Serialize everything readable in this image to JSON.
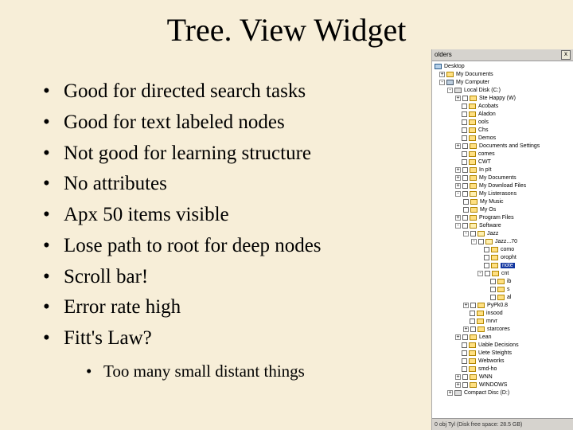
{
  "title": "Tree. View Widget",
  "bullets": [
    "Good for directed search tasks",
    "Good for text labeled nodes",
    "Not good for learning structure",
    "No attributes",
    "Apx 50 items visible",
    "Lose path to root for deep nodes",
    "Scroll bar!",
    "Error rate high",
    "Fitt's Law?"
  ],
  "sub_bullet": "Too many small distant things",
  "explorer": {
    "panel_title": "olders",
    "close_glyph": "x",
    "status": "0 obj Tyl (Disk free space: 28.5 GB)",
    "expander_minus": "-",
    "expander_plus": "+",
    "nodes": {
      "desktop": "Desktop",
      "my_documents": "My Documents",
      "my_computer": "My Computer",
      "local_disk": "Local Disk (C:)",
      "ste_happy": "Ste Happy (W)",
      "acobats": "Acobats",
      "aladon": "Aladon",
      "ools": "ools",
      "chs": "Chs",
      "demos": "Demos",
      "docs_settings": "Documents and Settings",
      "comes": "comes",
      "cwt": "CWT",
      "in_pit": "In pIt",
      "my_docs2": "My Documents",
      "my_download": "My Download Files",
      "my_lister": "My Listerasons",
      "my_music": "My Music",
      "my_os": "My Os",
      "program_files": "Program Files",
      "software": "Software",
      "jazz": "Jazz",
      "jazz_sub": "Jazz...70",
      "como": "como",
      "oropht": "oropht",
      "sel_item": "note",
      "cnt": "cnt",
      "ib": "ib",
      "s": "s",
      "al": "al",
      "pypk08": "PyPk0.8",
      "insood": "insood",
      "mrvr": "mrvr",
      "starcores": "starcores",
      "lean": "Lean",
      "uable": "Uable Decisions",
      "uete": "Uete Steights",
      "webworks": "Webworks",
      "smd_ho": "smd-ho",
      "wnn": "WNN",
      "windows": "WINDOWS",
      "cd_drive": "Compact Disc (D:)"
    }
  }
}
